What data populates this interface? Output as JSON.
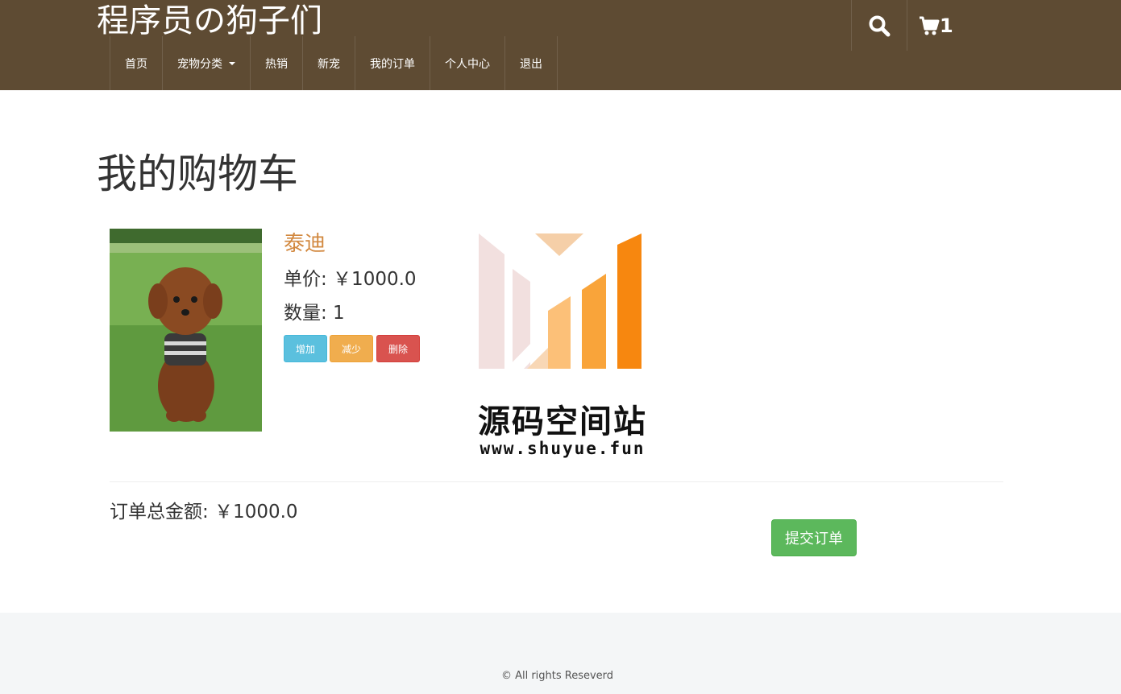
{
  "header": {
    "brand": "程序员の狗子们",
    "cart_count": "1",
    "nav": [
      {
        "label": "首页"
      },
      {
        "label": "宠物分类",
        "dropdown": true
      },
      {
        "label": "热销"
      },
      {
        "label": "新宠"
      },
      {
        "label": "我的订单"
      },
      {
        "label": "个人中心"
      },
      {
        "label": "退出"
      }
    ]
  },
  "main": {
    "title": "我的购物车",
    "cart_item": {
      "name": "泰迪",
      "price": "单价: ￥1000.0",
      "quantity": "数量: 1",
      "buttons": {
        "add": "增加",
        "decrease": "减少",
        "delete": "删除"
      }
    },
    "watermark": {
      "text": "源码空间站",
      "url": "www.shuyue.fun"
    },
    "total": "订单总金额: ￥1000.0",
    "submit_label": "提交订单"
  },
  "footer": {
    "copyright": "© All rights Reseverd"
  },
  "colors": {
    "header_bg": "#5e4b33",
    "product_name": "#d2883f",
    "submit": "#5cb85c",
    "add": "#5bc0de",
    "decrease": "#f0ad4e",
    "delete": "#d9534f"
  },
  "icons": {
    "search": "search-icon",
    "cart": "cart-icon"
  }
}
